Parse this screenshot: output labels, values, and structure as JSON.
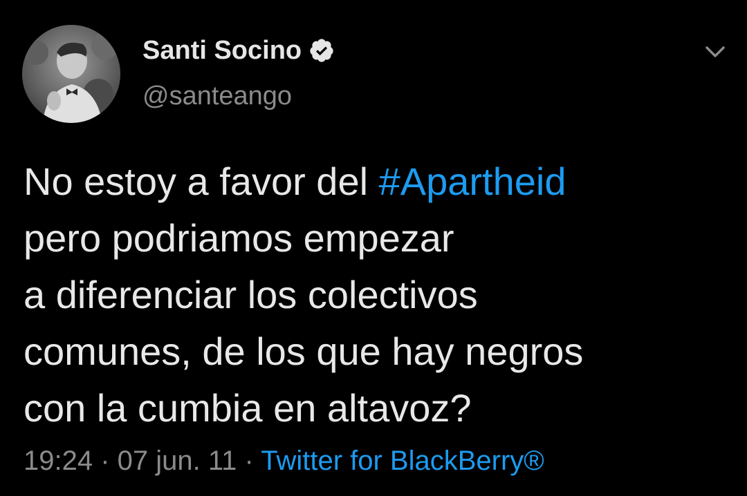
{
  "colors": {
    "background": "#000000",
    "text": "#e8e8e8",
    "secondary": "#8b8b8b",
    "link": "#1d9bf0"
  },
  "user": {
    "display_name": "Santi Socino",
    "handle": "@santeango",
    "verified_icon": "verified-badge-icon",
    "avatar_icon": "user-avatar"
  },
  "tweet": {
    "text_before": "No estoy a favor del ",
    "hashtag": "#Apartheid",
    "text_after": "\npero podriamos empezar\na diferenciar los colectivos\ncomunes, de los que hay negros\ncon la cumbia en altavoz?"
  },
  "meta": {
    "time": "19:24",
    "separator": " · ",
    "date": "07 jun. 11",
    "source": "Twitter for BlackBerry®"
  },
  "menu_icon": "chevron-down-icon"
}
